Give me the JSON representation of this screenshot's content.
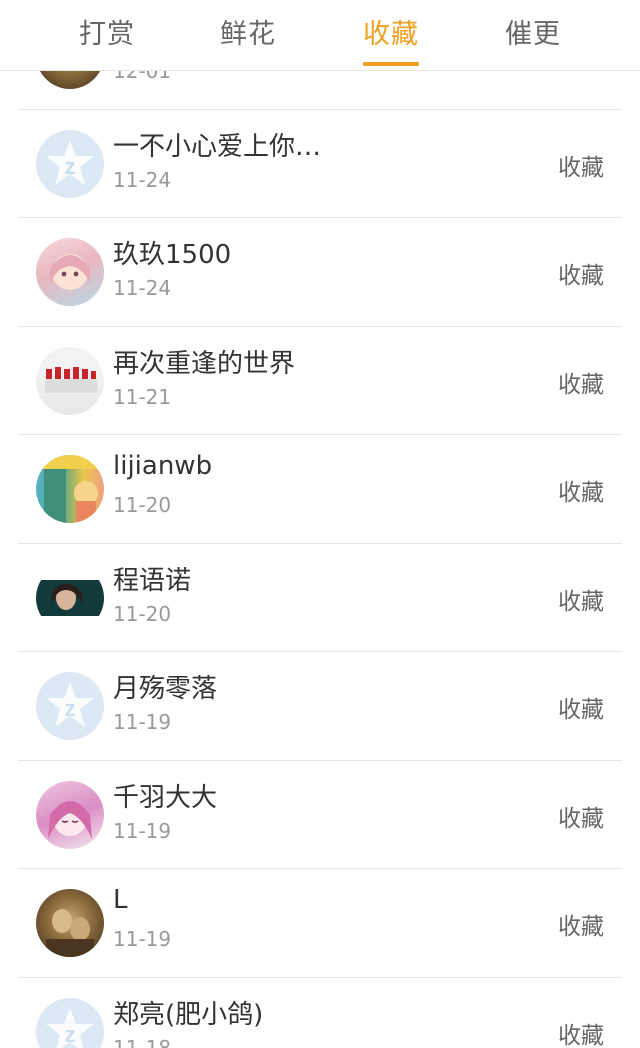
{
  "tabs": [
    {
      "label": "打赏",
      "active": false
    },
    {
      "label": "鲜花",
      "active": false
    },
    {
      "label": "收藏",
      "active": true
    },
    {
      "label": "催更",
      "active": false
    }
  ],
  "colors": {
    "accent": "#f0a020",
    "text_primary": "#333333",
    "text_secondary": "#999999",
    "divider": "#e6e6e6"
  },
  "list": {
    "rows": [
      {
        "name": "",
        "date": "12-01",
        "action": "",
        "avatar": "sepia-photo-avatar"
      },
      {
        "name": "一不小心爱上你…",
        "date": "11-24",
        "action": "收藏",
        "avatar": "default-avatar"
      },
      {
        "name": "玖玖1500",
        "date": "11-24",
        "action": "收藏",
        "avatar": "anime-girl-avatar"
      },
      {
        "name": "再次重逢的世界",
        "date": "11-21",
        "action": "收藏",
        "avatar": "dancers-avatar"
      },
      {
        "name": "lijianwb",
        "date": "11-20",
        "action": "收藏",
        "avatar": "cartoon-avatar"
      },
      {
        "name": "程语诺",
        "date": "11-20",
        "action": "收藏",
        "avatar": "photo-avatar"
      },
      {
        "name": "月殇零落",
        "date": "11-19",
        "action": "收藏",
        "avatar": "default-avatar"
      },
      {
        "name": "千羽大大",
        "date": "11-19",
        "action": "收藏",
        "avatar": "anime-pink-avatar"
      },
      {
        "name": "L",
        "date": "11-19",
        "action": "收藏",
        "avatar": "sepia-photo-avatar"
      },
      {
        "name": "郑亮(肥小鸽)",
        "date": "11-18",
        "action": "收藏",
        "avatar": "default-avatar"
      }
    ]
  }
}
